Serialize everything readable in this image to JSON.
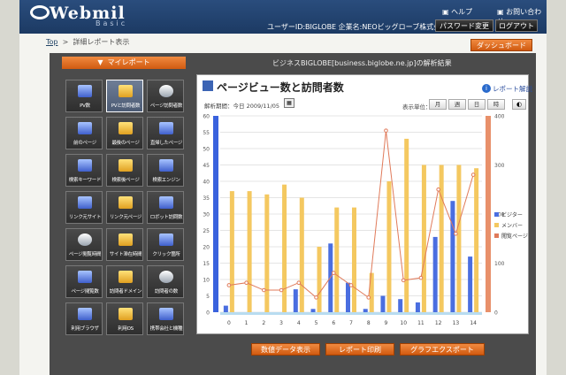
{
  "header": {
    "logo": "Webmil",
    "logo_sub": "Basic",
    "help": "ヘルプ",
    "contact": "お問い合わせ",
    "user_info": "ユーザーID:BIGLOBE 企業名:NEOビッグローブ株式会社",
    "password_button": "パスワード変更",
    "logout_button": "ログアウト"
  },
  "breadcrumb": {
    "top": "Top",
    "sep": ">",
    "current": "詳細レポート表示"
  },
  "dashboard_button": "ダッシュボード",
  "myreport_tab": "マイレポート",
  "analysis_title": "ビジネスBIGLOBE[business.biglobe.ne.jp]の解析結果",
  "menu": [
    {
      "label": "PV数",
      "icon": "pv-icon",
      "active": false
    },
    {
      "label": "PVと訪問者数",
      "icon": "pv-visitors-icon",
      "active": true
    },
    {
      "label": "ページ訪問者数",
      "icon": "page-visitors-icon",
      "active": false
    },
    {
      "label": "前のページ",
      "icon": "prev-page-icon",
      "active": false
    },
    {
      "label": "最後のページ",
      "icon": "last-page-icon",
      "active": false
    },
    {
      "label": "直帰したページ",
      "icon": "bounce-page-icon",
      "active": false
    },
    {
      "label": "検索キーワード",
      "icon": "search-keyword-icon",
      "active": false
    },
    {
      "label": "検索後ページ",
      "icon": "search-page-icon",
      "active": false
    },
    {
      "label": "検索エンジン",
      "icon": "search-engine-icon",
      "active": false
    },
    {
      "label": "リンク元サイト",
      "icon": "link-site-icon",
      "active": false
    },
    {
      "label": "リンク元ページ",
      "icon": "link-page-icon",
      "active": false
    },
    {
      "label": "ロボット訪問数",
      "icon": "robot-icon",
      "active": false
    },
    {
      "label": "ページ閲覧時間",
      "icon": "page-time-icon",
      "active": false
    },
    {
      "label": "サイト滞在時間",
      "icon": "site-time-icon",
      "active": false
    },
    {
      "label": "クリック箇所",
      "icon": "click-icon",
      "active": false
    },
    {
      "label": "ページ閲覧数",
      "icon": "page-count-icon",
      "active": false
    },
    {
      "label": "訪問者ドメイン",
      "icon": "domain-icon",
      "active": false
    },
    {
      "label": "訪問者の数",
      "icon": "visitor-count-icon",
      "active": false
    },
    {
      "label": "利用ブラウザ",
      "icon": "browser-icon",
      "active": false
    },
    {
      "label": "利用OS",
      "icon": "os-icon",
      "active": false
    },
    {
      "label": "携帯会社と機種",
      "icon": "mobile-icon",
      "active": false
    }
  ],
  "report": {
    "title": "ページビュー数と訪問者数",
    "help_link": "レポート解説",
    "period": "解析期間：今日 2009/11/05",
    "unit_label": "表示単位：",
    "units": [
      "月",
      "週",
      "日",
      "時"
    ]
  },
  "chart_data": {
    "type": "bar",
    "x": [
      0,
      1,
      2,
      3,
      4,
      5,
      6,
      7,
      8,
      9,
      10,
      11,
      12,
      13,
      14
    ],
    "ylim_left": [
      0,
      60
    ],
    "yticks_left": [
      0,
      5,
      10,
      15,
      20,
      25,
      30,
      35,
      40,
      45,
      50,
      55,
      60
    ],
    "ylim_right": [
      0,
      400
    ],
    "yticks_right": [
      0,
      100,
      200,
      300,
      400
    ],
    "series": [
      {
        "name": "ビジター",
        "color": "#4a6ee0",
        "axis": "left",
        "values": [
          2,
          0,
          0,
          0,
          7,
          1,
          21,
          9,
          1,
          5,
          4,
          3,
          23,
          34,
          17
        ]
      },
      {
        "name": "メンバー",
        "color": "#f4c860",
        "axis": "left",
        "values": [
          37,
          37,
          36,
          39,
          35,
          20,
          32,
          32,
          12,
          40,
          53,
          45,
          45,
          45,
          44
        ]
      },
      {
        "name": "閲覧ページ",
        "color": "#e07a5a",
        "axis": "right",
        "type": "line",
        "values": [
          55,
          60,
          45,
          45,
          60,
          30,
          80,
          55,
          30,
          370,
          65,
          70,
          250,
          160,
          280
        ]
      }
    ]
  },
  "buttons": {
    "csv": "数値データ表示",
    "print": "レポート印刷",
    "export": "グラフエクスポート"
  }
}
